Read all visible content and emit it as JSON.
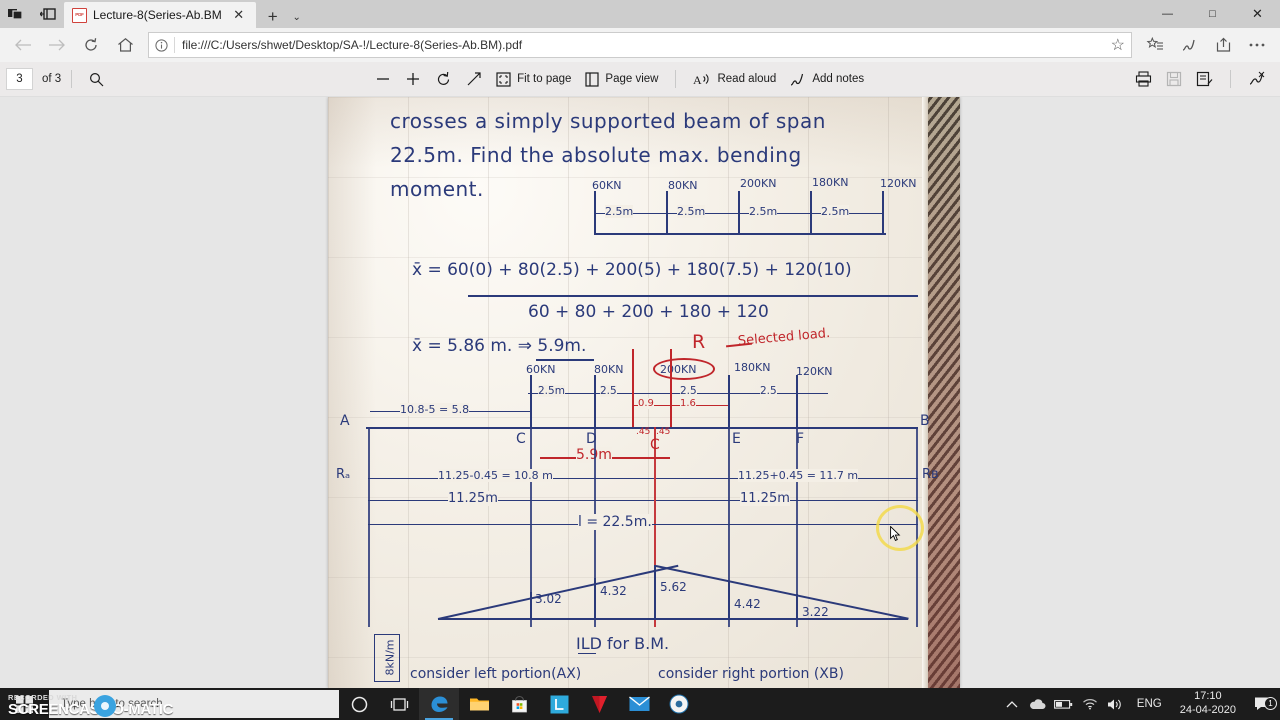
{
  "window": {
    "minimize_label": "—",
    "maximize_label": "□",
    "close_label": "✕"
  },
  "tabs": {
    "items": [
      {
        "title": "Lecture-8(Series-Ab.BM",
        "favicon": "pdf-icon",
        "close_label": "✕"
      }
    ],
    "new_tab_label": "+",
    "tab_menu_label": "⌄",
    "set_tabs_aside_icon": "tabs-aside-icon",
    "tabs_you_set_aside_icon": "tabs-restore-icon"
  },
  "nav": {
    "back_label": "←",
    "forward_label": "→",
    "refresh_label": "↻",
    "home_label": "home-icon",
    "info_label": "ⓘ",
    "url": "file:///C:/Users/shwet/Desktop/SA-!/Lecture-8(Series-Ab.BM).pdf",
    "star_label": "☆",
    "favorites_icon": "favorites-list-icon",
    "notes_icon": "web-notes-icon",
    "share_icon": "share-icon",
    "more_icon": "more-settings-icon"
  },
  "pdf_toolbar": {
    "page_number": "3",
    "page_total": "of 3",
    "search_icon": "search-icon",
    "zoom_out_label": "−",
    "zoom_in_label": "+",
    "rotate_label": "rotate-icon",
    "expand_label": "expand-icon",
    "fit_icon": "fit-to-page-icon",
    "fit_label": "Fit to page",
    "page_view_icon": "page-view-icon",
    "page_view_label": "Page view",
    "read_aloud_icon": "read-aloud-icon",
    "read_aloud_label": "Read aloud",
    "add_notes_icon": "add-notes-icon",
    "add_notes_label": "Add notes",
    "print_icon": "print-icon",
    "save_icon": "save-icon",
    "save_as_icon": "save-as-icon",
    "highlight_icon": "highlight-icon"
  },
  "document": {
    "question": {
      "line1": "crosses a simply supported beam of span",
      "line2": "22.5m. Find the absolute max. bending",
      "line3": "moment."
    },
    "top_load_diagram": {
      "loads": [
        "60KN",
        "80KN",
        "200KN",
        "180KN",
        "120KN"
      ],
      "spacings": [
        "2.5m",
        "2.5m",
        "2.5m",
        "2.5m"
      ]
    },
    "centroid_calc": {
      "numerator": "x̄ = 60(0) + 80(2.5) + 200(5) + 180(7.5) + 120(10)",
      "denominator": "60 + 80 + 200 + 180 + 120",
      "result": "x̄ = 5.86 m. ⇒ 5.9m.",
      "resultant_label": "R",
      "selected_load_note": "Selected load."
    },
    "beam_diagram": {
      "supports": {
        "left": "A",
        "right": "B"
      },
      "reactions": {
        "left": "Rₐ",
        "right": "Rʙ"
      },
      "points": [
        "C",
        "D",
        "C",
        "E",
        "F"
      ],
      "loads": [
        "60KN",
        "80KN",
        "200KN",
        "180KN",
        "120KN"
      ],
      "spacings": [
        "2.5m",
        "2.5",
        "2.5",
        "2.5"
      ],
      "left_dim": "10.8-5 = 5.8",
      "red_dims": [
        "0.9",
        "1.6",
        ".45",
        ".45"
      ],
      "red_span": "5.9m",
      "dim_left_full": "11.25-0.45 = 10.8 m",
      "dim_right_full": "11.25+0.45 = 11.7 m",
      "half_left": "11.25m",
      "half_right": "11.25m",
      "total_span": "l = 22.5m.",
      "circled_load": "200KN"
    },
    "ild": {
      "title": "ILD for B.M.",
      "ordinates": [
        "3.02",
        "4.32",
        "5.62",
        "4.42",
        "3.22"
      ],
      "udl_label": "8kN/m"
    },
    "footnotes": {
      "left": "consider left portion(AX)",
      "right": "consider right portion (XB)"
    }
  },
  "taskbar": {
    "start_icon": "windows-start-icon",
    "search_placeholder": "Type here to search",
    "cortana_icon": "cortana-icon",
    "task_view_icon": "task-view-icon",
    "apps": [
      {
        "name": "edge-icon",
        "label": "Microsoft Edge"
      },
      {
        "name": "file-explorer-icon",
        "label": "File Explorer"
      },
      {
        "name": "microsoft-store-icon",
        "label": "Microsoft Store"
      },
      {
        "name": "lenovo-vantage-icon",
        "label": "L"
      },
      {
        "name": "mcafee-icon",
        "label": "McAfee"
      },
      {
        "name": "mail-icon",
        "label": "Mail"
      },
      {
        "name": "screencast-recorder-icon",
        "label": "Screencast-O-Matic"
      }
    ],
    "tray": {
      "show_hidden_icon": "chevron-up-icon",
      "onedrive_icon": "onedrive-icon",
      "battery_icon": "battery-icon",
      "wifi_icon": "wifi-icon",
      "volume_icon": "volume-icon",
      "language": "ENG",
      "time": "17:10",
      "date": "24-04-2020",
      "notification_icon": "notifications-icon",
      "notification_count": "1"
    }
  },
  "watermark": {
    "line1": "RECORDED WITH",
    "line2": "SCREENCAST-O-MATIC"
  },
  "colors": {
    "ink_blue": "#2b3a7a",
    "ink_red": "#c0262b",
    "accent": "#4aa3df",
    "highlight": "#f2d94e"
  }
}
